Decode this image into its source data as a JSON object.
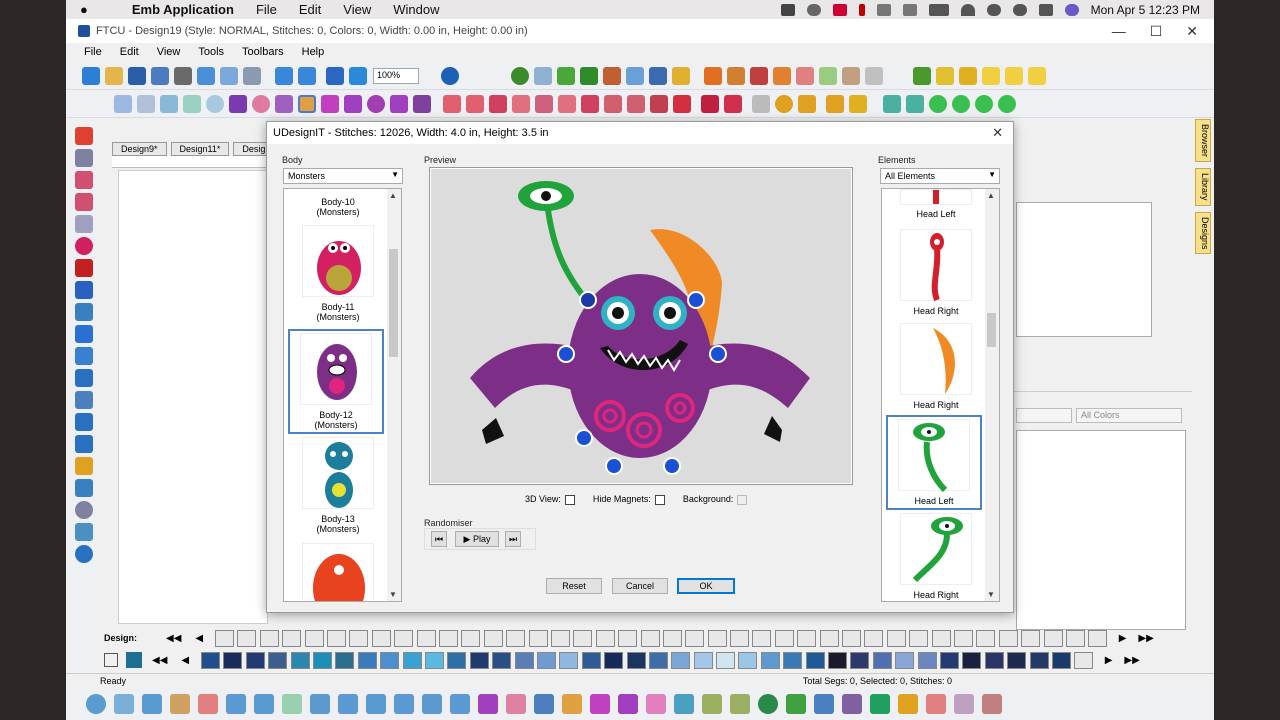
{
  "mac_menu": {
    "apple": "",
    "app": "Emb Application",
    "items": [
      "File",
      "Edit",
      "View",
      "Window"
    ],
    "clock": "Mon Apr 5  12:23 PM"
  },
  "window": {
    "title": "FTCU - Design19 (Style: NORMAL, Stitches: 0, Colors: 0, Width: 0.00 in, Height: 0.00 in)",
    "menu": [
      "File",
      "Edit",
      "View",
      "Tools",
      "Toolbars",
      "Help"
    ],
    "zoom": "100%",
    "doc_tabs": [
      "Design9*",
      "Design11*",
      "Design"
    ],
    "side_tabs": [
      "Browser",
      "Library",
      "Designs"
    ],
    "colors_combo": "All Colors",
    "design_label": "Design:",
    "status_left": "Ready",
    "status_right": "Total Segs: 0, Selected: 0, Stitches: 0"
  },
  "dialog": {
    "title": "UDesignIT - Stitches: 12026, Width: 4.0 in, Height: 3.5 in",
    "body_label": "Body",
    "body_combo": "Monsters",
    "preview_label": "Preview",
    "elements_label": "Elements",
    "elements_combo": "All Elements",
    "body_items": [
      {
        "name": "Body-10",
        "sub": "(Monsters)"
      },
      {
        "name": "Body-11",
        "sub": "(Monsters)"
      },
      {
        "name": "Body-12",
        "sub": "(Monsters)"
      },
      {
        "name": "Body-13",
        "sub": "(Monsters)"
      }
    ],
    "element_items": [
      "Head Left",
      "Head Right",
      "Head Right",
      "Head Left",
      "Head Right"
    ],
    "view3d_label": "3D View:",
    "hide_magnets_label": "Hide Magnets:",
    "background_label": "Background:",
    "randomiser_label": "Randomiser",
    "play_label": "Play",
    "reset_label": "Reset",
    "cancel_label": "Cancel",
    "ok_label": "OK"
  },
  "palette_row1": [
    "#e8e8e8",
    "#e8e8e8",
    "#e8e8e8",
    "#e8e8e8",
    "#e8e8e8",
    "#e8e8e8",
    "#e8e8e8",
    "#e8e8e8",
    "#e8e8e8",
    "#e8e8e8",
    "#e8e8e8",
    "#e8e8e8",
    "#e8e8e8",
    "#e8e8e8",
    "#e8e8e8",
    "#e8e8e8",
    "#e8e8e8",
    "#e8e8e8",
    "#e8e8e8",
    "#e8e8e8",
    "#e8e8e8",
    "#e8e8e8",
    "#e8e8e8",
    "#e8e8e8",
    "#e8e8e8",
    "#e8e8e8",
    "#e8e8e8",
    "#e8e8e8",
    "#e8e8e8",
    "#e8e8e8",
    "#e8e8e8",
    "#e8e8e8",
    "#e8e8e8",
    "#e8e8e8",
    "#e8e8e8",
    "#e8e8e8",
    "#e8e8e8",
    "#e8e8e8",
    "#e8e8e8",
    "#e8e8e8"
  ],
  "palette_row2": [
    "#1f4e8c",
    "#1a2c5c",
    "#233b74",
    "#3b5e8f",
    "#2a87b0",
    "#1b8fb8",
    "#2c6e8e",
    "#3a7bbd",
    "#4b8fcf",
    "#3aa2d0",
    "#5bb8e0",
    "#2f6fa8",
    "#1e3a6e",
    "#2a4f86",
    "#5a7fb7",
    "#6f9bd0",
    "#8fb7e0",
    "#2d5c94",
    "#142a5a",
    "#1c3560",
    "#3d6ea8",
    "#7aa7d8",
    "#a4c6e8",
    "#cfe6f0",
    "#9cc6e6",
    "#5e9ad0",
    "#3b79b6",
    "#1f5a97",
    "#1a1a2a",
    "#2b3a6a",
    "#4f6fb0",
    "#8aa6d8",
    "#6b86c0",
    "#243a72",
    "#1a2040",
    "#2a3566",
    "#1c2a50",
    "#223a68",
    "#1a3a6c",
    "#e8e8e8"
  ],
  "colors": {
    "accent": "#4d83c4",
    "monster_purple": "#7d2e86",
    "magnet_blue": "#1a4fd6"
  }
}
